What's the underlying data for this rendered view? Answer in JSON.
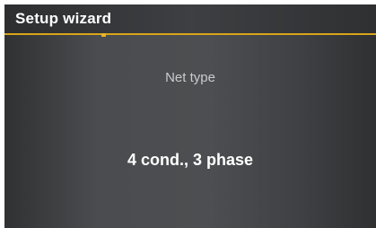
{
  "header": {
    "title": "Setup wizard"
  },
  "setting": {
    "label": "Net type",
    "value": "4 cond., 3 phase"
  },
  "colors": {
    "accent": "#d9a51a",
    "background": "#4a4c4f",
    "text_primary": "#ffffff",
    "text_secondary": "#c9cbcd"
  }
}
